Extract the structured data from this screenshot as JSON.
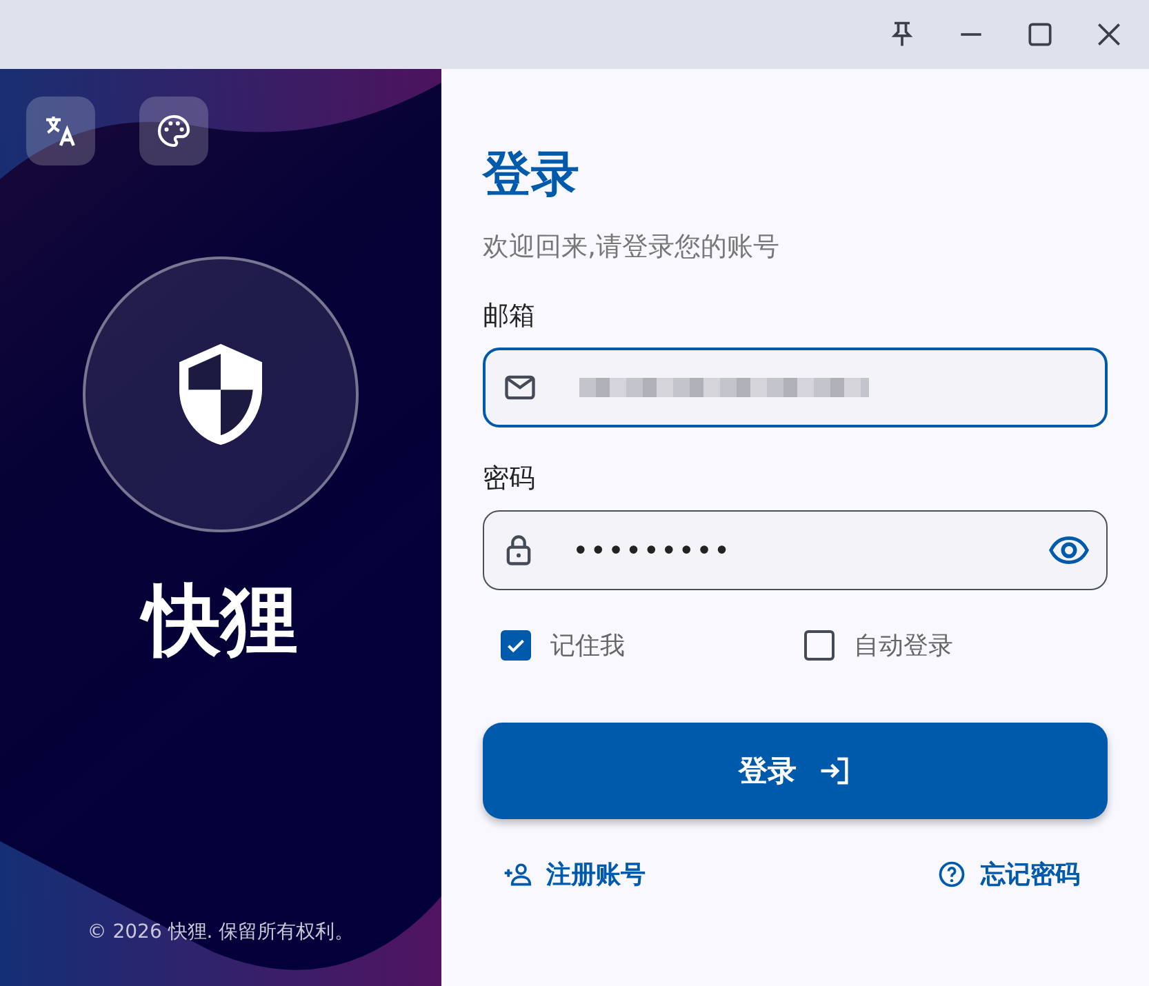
{
  "window": {
    "controls": [
      {
        "kind": "pin"
      },
      {
        "kind": "minimize"
      },
      {
        "kind": "maximize"
      },
      {
        "kind": "close"
      }
    ]
  },
  "brand": {
    "tools": [
      {
        "kind": "translate"
      },
      {
        "kind": "palette"
      }
    ],
    "name": "快狸",
    "footer": "© 2026 快狸. 保留所有权利。"
  },
  "form": {
    "title": "登录",
    "subtitle": "欢迎回来,请登录您的账号",
    "fields": [
      {
        "kind": "email",
        "label": "邮箱",
        "focused": true
      },
      {
        "kind": "password",
        "label": "密码",
        "value": "•••••••••",
        "focused": false
      }
    ],
    "options": [
      {
        "label": "记住我",
        "checked": true
      },
      {
        "label": "自动登录",
        "checked": false
      }
    ],
    "submit": "登录",
    "links": [
      {
        "kind": "register",
        "label": "注册账号"
      },
      {
        "kind": "help",
        "label": "忘记密码"
      }
    ]
  }
}
